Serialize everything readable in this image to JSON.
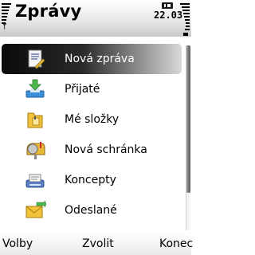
{
  "status": {
    "title": "Zprávy",
    "clock": "22.03"
  },
  "menu": {
    "items": [
      {
        "label": "Nová zpráva",
        "icon": "new-message-icon",
        "selected": true
      },
      {
        "label": "Přijaté",
        "icon": "inbox-icon",
        "selected": false
      },
      {
        "label": "Mé složky",
        "icon": "my-folders-icon",
        "selected": false
      },
      {
        "label": "Nová schránka",
        "icon": "mailbox-icon",
        "selected": false
      },
      {
        "label": "Koncepty",
        "icon": "drafts-icon",
        "selected": false
      },
      {
        "label": "Odeslané",
        "icon": "sent-icon",
        "selected": false
      }
    ]
  },
  "softkeys": {
    "left": "Volby",
    "middle": "Zvolit",
    "right": "Konec"
  },
  "colors": {
    "selection": "#111111",
    "selected_text": "#ffffff",
    "text": "#000000"
  }
}
